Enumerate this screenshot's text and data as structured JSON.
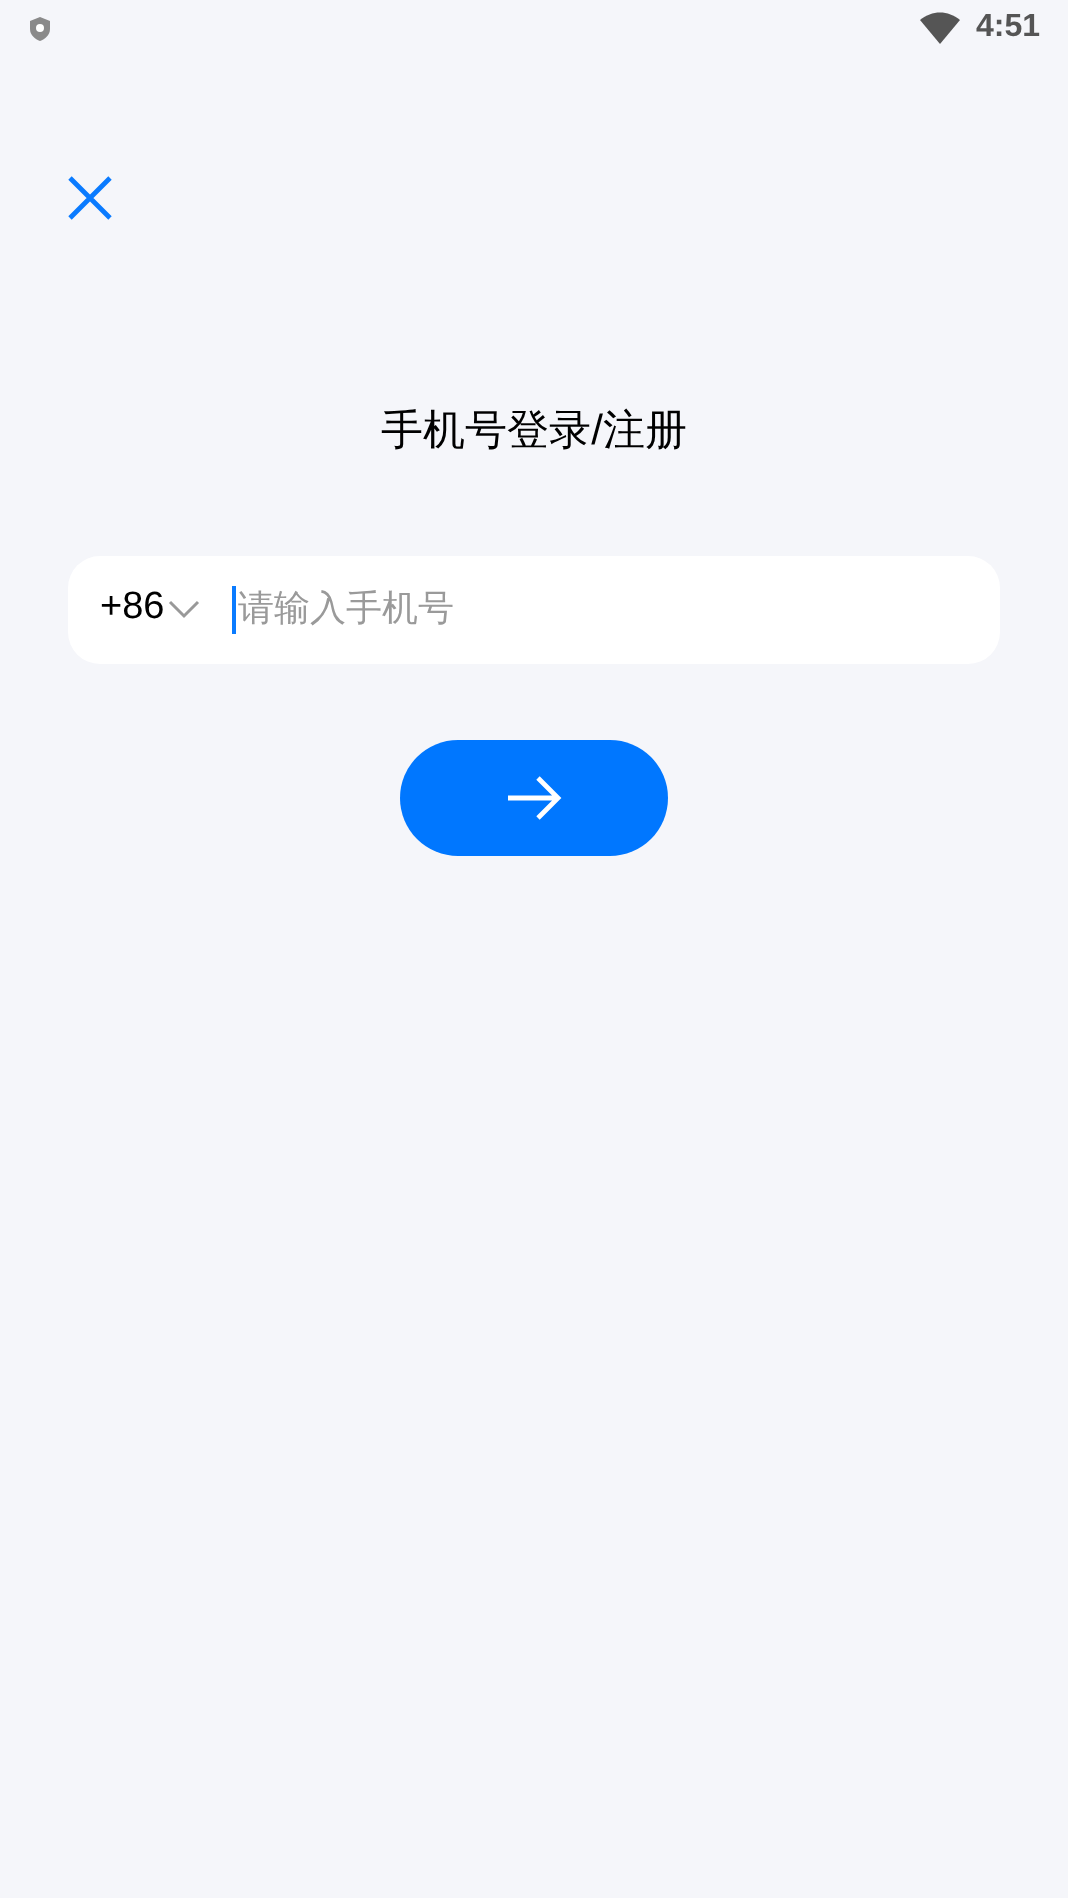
{
  "status_bar": {
    "time": "4:51"
  },
  "title": "手机号登录/注册",
  "phone_field": {
    "country_code": "+86",
    "placeholder": "请输入手机号"
  }
}
